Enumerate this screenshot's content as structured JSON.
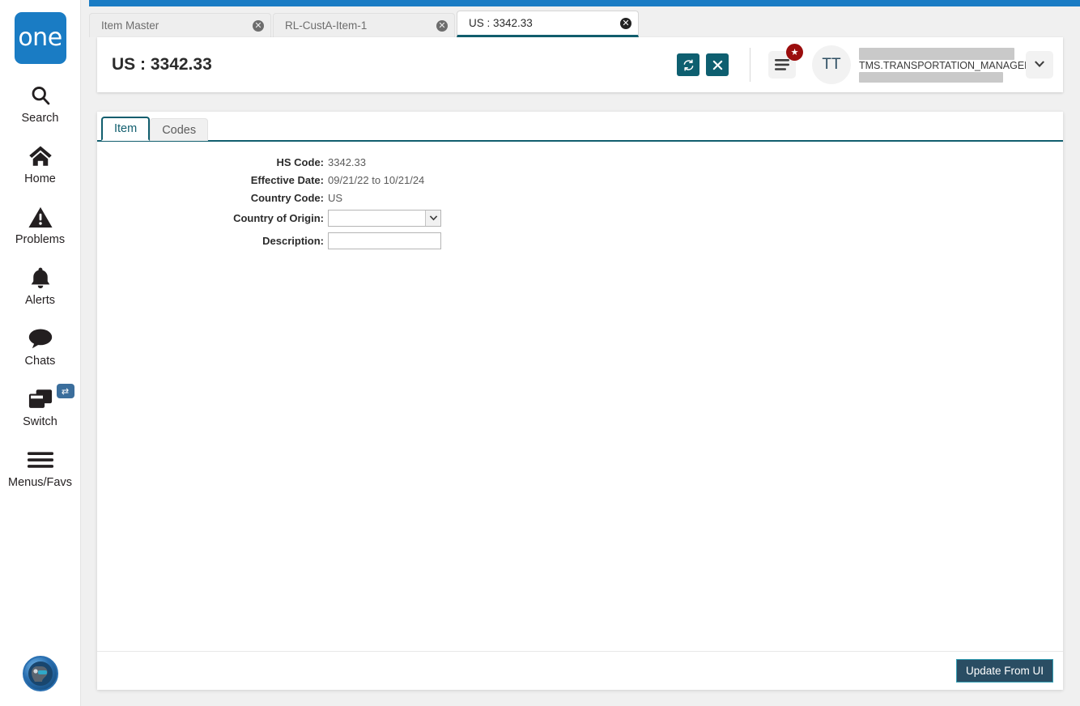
{
  "brand": {
    "logo_text": "one"
  },
  "rail": {
    "items": [
      {
        "label": "Search",
        "icon": "search-icon"
      },
      {
        "label": "Home",
        "icon": "home-icon"
      },
      {
        "label": "Problems",
        "icon": "warning-triangle-icon"
      },
      {
        "label": "Alerts",
        "icon": "bell-icon"
      },
      {
        "label": "Chats",
        "icon": "chat-bubble-icon"
      },
      {
        "label": "Switch",
        "icon": "windows-stack-icon",
        "badge_icon": "swap-arrows-icon"
      },
      {
        "label": "Menus/Favs",
        "icon": "hamburger-icon"
      }
    ],
    "assistant_icon": "ai-assistant-avatar-icon"
  },
  "doc_tabs": [
    {
      "title": "Item Master",
      "active": false,
      "close_icon": "close-circle-icon"
    },
    {
      "title": "RL-CustA-Item-1",
      "active": false,
      "close_icon": "close-circle-icon"
    },
    {
      "title": "US : 3342.33",
      "active": true,
      "close_icon": "close-circle-icon"
    }
  ],
  "header": {
    "title": "US : 3342.33",
    "refresh_icon": "refresh-icon",
    "close_icon": "close-x-icon",
    "menu_icon": "hamburger-menu-icon",
    "menu_badge_icon": "star-icon",
    "avatar_initials": "TT",
    "user_role": "TMS.TRANSPORTATION_MANAGER",
    "chevron_icon": "chevron-down-icon"
  },
  "inner_tabs": [
    {
      "label": "Item",
      "active": true
    },
    {
      "label": "Codes",
      "active": false
    }
  ],
  "form": {
    "hs_code_label": "HS Code:",
    "hs_code_value": "3342.33",
    "effective_date_label": "Effective Date:",
    "effective_date_value": "09/21/22 to 10/21/24",
    "country_code_label": "Country Code:",
    "country_code_value": "US",
    "country_of_origin_label": "Country of Origin:",
    "country_of_origin_value": "",
    "description_label": "Description:",
    "description_value": ""
  },
  "footer": {
    "update_button_label": "Update From UI"
  },
  "colors": {
    "brand_blue": "#1a7cc4",
    "teal": "#0e5f70",
    "tab_teal": "#115e6e",
    "badge_red": "#9b0d0d",
    "footer_button_bg": "#2a4d63",
    "footer_button_border": "#35a0b5"
  }
}
